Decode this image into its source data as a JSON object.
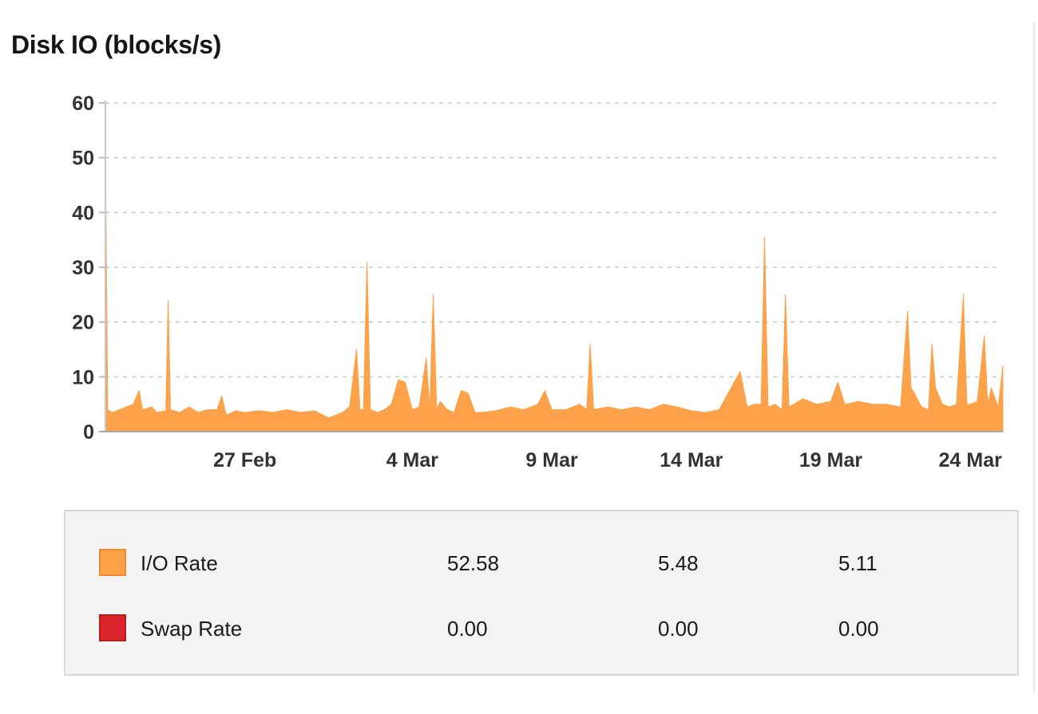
{
  "panel": {
    "title": "Disk IO (blocks/s)"
  },
  "legend": [
    {
      "name": "I/O Rate",
      "color": "#fba24a",
      "border": "#ee8a2c",
      "values": [
        "52.58",
        "5.48",
        "5.11"
      ]
    },
    {
      "name": "Swap Rate",
      "color": "#d8262b",
      "border": "#b51c20",
      "values": [
        "0.00",
        "0.00",
        "0.00"
      ]
    }
  ],
  "chart_data": {
    "type": "area",
    "xlabel": "",
    "ylabel": "",
    "x_range": [
      "2024-02-22",
      "2024-03-25"
    ],
    "x_ticks": [
      "27 Feb",
      "4 Mar",
      "9 Mar",
      "14 Mar",
      "19 Mar",
      "24 Mar"
    ],
    "x_tick_dates": [
      "2024-02-27",
      "2024-03-04",
      "2024-03-09",
      "2024-03-14",
      "2024-03-19",
      "2024-03-24"
    ],
    "ylim": [
      0,
      60
    ],
    "y_ticks": [
      0,
      10,
      20,
      30,
      40,
      50,
      60
    ],
    "grid": "horizontal dashed",
    "legend_position": "bottom",
    "series": [
      {
        "name": "I/O Rate",
        "color": "#fba24a",
        "points": [
          [
            "2024-02-22 00:00",
            52.0
          ],
          [
            "2024-02-22 02:00",
            4.0
          ],
          [
            "2024-02-22 06:00",
            3.5
          ],
          [
            "2024-02-22 12:00",
            4.0
          ],
          [
            "2024-02-23 00:00",
            5.0
          ],
          [
            "2024-02-23 05:00",
            7.5
          ],
          [
            "2024-02-23 08:00",
            4.0
          ],
          [
            "2024-02-23 16:00",
            4.5
          ],
          [
            "2024-02-23 20:00",
            3.5
          ],
          [
            "2024-02-24 04:00",
            3.8
          ],
          [
            "2024-02-24 06:00",
            24.0
          ],
          [
            "2024-02-24 08:00",
            4.0
          ],
          [
            "2024-02-24 16:00",
            3.5
          ],
          [
            "2024-02-25 00:00",
            4.5
          ],
          [
            "2024-02-25 08:00",
            3.5
          ],
          [
            "2024-02-25 16:00",
            4.0
          ],
          [
            "2024-02-26 00:00",
            4.0
          ],
          [
            "2024-02-26 04:00",
            6.5
          ],
          [
            "2024-02-26 08:00",
            3.0
          ],
          [
            "2024-02-26 16:00",
            3.8
          ],
          [
            "2024-02-27 00:00",
            3.5
          ],
          [
            "2024-02-27 12:00",
            3.8
          ],
          [
            "2024-02-28 00:00",
            3.5
          ],
          [
            "2024-02-28 12:00",
            4.0
          ],
          [
            "2024-02-29 00:00",
            3.5
          ],
          [
            "2024-02-29 12:00",
            3.8
          ],
          [
            "2024-03-01 00:00",
            2.5
          ],
          [
            "2024-03-01 12:00",
            3.5
          ],
          [
            "2024-03-01 18:00",
            4.5
          ],
          [
            "2024-03-02 00:00",
            15.0
          ],
          [
            "2024-03-02 03:00",
            4.0
          ],
          [
            "2024-03-02 06:00",
            4.0
          ],
          [
            "2024-03-02 09:00",
            31.0
          ],
          [
            "2024-03-02 12:00",
            4.0
          ],
          [
            "2024-03-02 18:00",
            3.5
          ],
          [
            "2024-03-03 00:00",
            4.0
          ],
          [
            "2024-03-03 06:00",
            5.0
          ],
          [
            "2024-03-03 12:00",
            9.5
          ],
          [
            "2024-03-03 18:00",
            9.0
          ],
          [
            "2024-03-04 00:00",
            4.0
          ],
          [
            "2024-03-04 06:00",
            4.5
          ],
          [
            "2024-03-04 12:00",
            13.5
          ],
          [
            "2024-03-04 15:00",
            4.0
          ],
          [
            "2024-03-04 18:00",
            25.0
          ],
          [
            "2024-03-04 21:00",
            4.0
          ],
          [
            "2024-03-05 00:00",
            5.5
          ],
          [
            "2024-03-05 06:00",
            4.0
          ],
          [
            "2024-03-05 12:00",
            3.5
          ],
          [
            "2024-03-05 18:00",
            7.5
          ],
          [
            "2024-03-06 00:00",
            7.0
          ],
          [
            "2024-03-06 06:00",
            3.5
          ],
          [
            "2024-03-06 12:00",
            3.5
          ],
          [
            "2024-03-07 00:00",
            3.8
          ],
          [
            "2024-03-07 12:00",
            4.5
          ],
          [
            "2024-03-08 00:00",
            4.0
          ],
          [
            "2024-03-08 12:00",
            5.0
          ],
          [
            "2024-03-08 18:00",
            7.5
          ],
          [
            "2024-03-09 00:00",
            4.0
          ],
          [
            "2024-03-09 12:00",
            4.0
          ],
          [
            "2024-03-10 00:00",
            5.0
          ],
          [
            "2024-03-10 06:00",
            4.0
          ],
          [
            "2024-03-10 09:00",
            16.0
          ],
          [
            "2024-03-10 12:00",
            4.0
          ],
          [
            "2024-03-11 00:00",
            4.5
          ],
          [
            "2024-03-11 12:00",
            4.0
          ],
          [
            "2024-03-12 00:00",
            4.5
          ],
          [
            "2024-03-12 12:00",
            4.0
          ],
          [
            "2024-03-13 00:00",
            5.0
          ],
          [
            "2024-03-13 12:00",
            4.5
          ],
          [
            "2024-03-14 00:00",
            3.8
          ],
          [
            "2024-03-14 12:00",
            3.5
          ],
          [
            "2024-03-15 00:00",
            4.0
          ],
          [
            "2024-03-15 18:00",
            11.0
          ],
          [
            "2024-03-16 00:00",
            4.5
          ],
          [
            "2024-03-16 06:00",
            5.0
          ],
          [
            "2024-03-16 12:00",
            5.0
          ],
          [
            "2024-03-16 15:00",
            35.5
          ],
          [
            "2024-03-16 18:00",
            4.5
          ],
          [
            "2024-03-17 00:00",
            5.0
          ],
          [
            "2024-03-17 06:00",
            4.0
          ],
          [
            "2024-03-17 09:00",
            25.0
          ],
          [
            "2024-03-17 12:00",
            4.5
          ],
          [
            "2024-03-18 00:00",
            6.0
          ],
          [
            "2024-03-18 12:00",
            5.0
          ],
          [
            "2024-03-19 00:00",
            5.5
          ],
          [
            "2024-03-19 06:00",
            9.0
          ],
          [
            "2024-03-19 12:00",
            5.0
          ],
          [
            "2024-03-20 00:00",
            5.5
          ],
          [
            "2024-03-20 12:00",
            5.0
          ],
          [
            "2024-03-21 00:00",
            5.0
          ],
          [
            "2024-03-21 12:00",
            4.5
          ],
          [
            "2024-03-21 18:00",
            22.0
          ],
          [
            "2024-03-21 21:00",
            8.0
          ],
          [
            "2024-03-22 00:00",
            7.0
          ],
          [
            "2024-03-22 06:00",
            4.5
          ],
          [
            "2024-03-22 12:00",
            4.0
          ],
          [
            "2024-03-22 15:00",
            16.0
          ],
          [
            "2024-03-22 18:00",
            8.0
          ],
          [
            "2024-03-23 00:00",
            5.0
          ],
          [
            "2024-03-23 06:00",
            4.5
          ],
          [
            "2024-03-23 12:00",
            5.0
          ],
          [
            "2024-03-23 18:00",
            25.0
          ],
          [
            "2024-03-23 21:00",
            5.0
          ],
          [
            "2024-03-24 00:00",
            5.0
          ],
          [
            "2024-03-24 06:00",
            5.5
          ],
          [
            "2024-03-24 12:00",
            17.5
          ],
          [
            "2024-03-24 15:00",
            5.0
          ],
          [
            "2024-03-24 18:00",
            8.0
          ],
          [
            "2024-03-25 00:00",
            4.5
          ],
          [
            "2024-03-25 04:00",
            12.0
          ]
        ]
      },
      {
        "name": "Swap Rate",
        "color": "#d8262b",
        "points": [
          [
            "2024-02-22 00:00",
            0.0
          ],
          [
            "2024-03-25 04:00",
            0.0
          ]
        ]
      }
    ]
  }
}
